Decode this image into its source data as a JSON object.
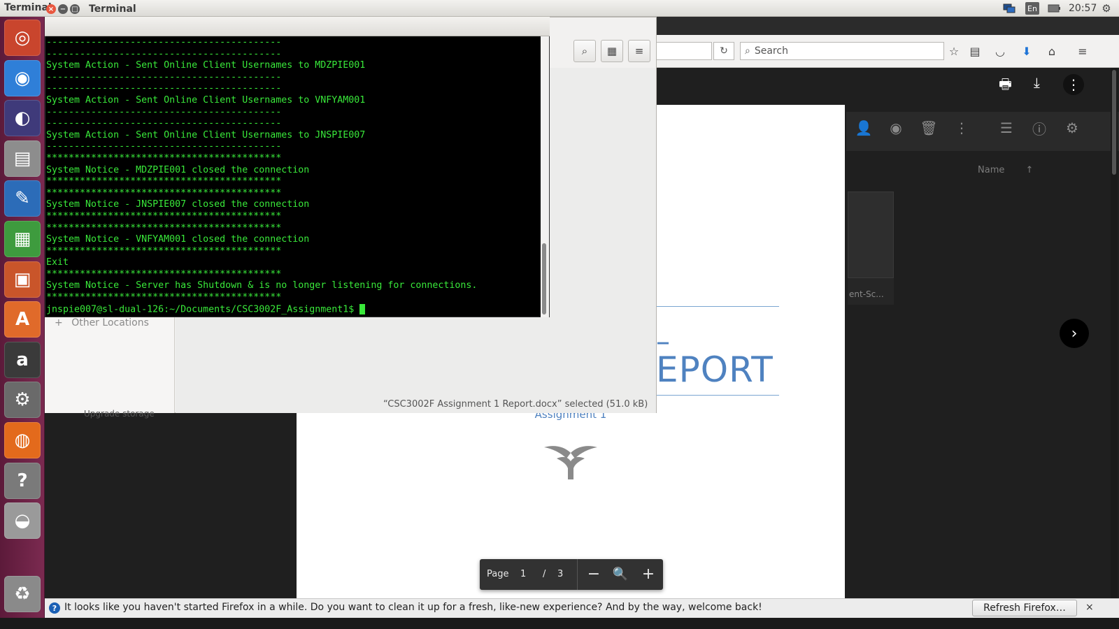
{
  "top_panel": {
    "title": "Terminal",
    "lang": "En",
    "clock": "20:57"
  },
  "launcher": {
    "items": [
      {
        "name": "ubuntu-dash",
        "glyph": "◎",
        "color": "#c9452d"
      },
      {
        "name": "chrome",
        "glyph": "◉",
        "color": "#2f7fd8"
      },
      {
        "name": "eclipse",
        "glyph": "◐",
        "color": "#3f3a7a"
      },
      {
        "name": "files",
        "glyph": "▤",
        "color": "#8d8d8d"
      },
      {
        "name": "writer",
        "glyph": "✎",
        "color": "#2c6cb8"
      },
      {
        "name": "calc",
        "glyph": "▦",
        "color": "#3e9b3e"
      },
      {
        "name": "impress",
        "glyph": "▣",
        "color": "#c9552a"
      },
      {
        "name": "software-center",
        "glyph": "A",
        "color": "#e06a2a"
      },
      {
        "name": "amazon",
        "glyph": "a",
        "color": "#3a3a3a"
      },
      {
        "name": "settings",
        "glyph": "⚙",
        "color": "#6a6a6a"
      },
      {
        "name": "firefox",
        "glyph": "◍",
        "color": "#e36a1c"
      },
      {
        "name": "help",
        "glyph": "?",
        "color": "#7a7a7a"
      },
      {
        "name": "disk",
        "glyph": "◒",
        "color": "#9a9a9a"
      },
      {
        "name": "trash",
        "glyph": "♻",
        "color": "#8a8a8a"
      }
    ]
  },
  "firefox": {
    "search_placeholder": "Search"
  },
  "drive": {
    "name_column": "Name",
    "file_label": "ent-Sc...",
    "upgrade_text": "Upgrade storage"
  },
  "document": {
    "title_dash": "–",
    "title_word": "EPORT",
    "subtitle": "Assignment 1"
  },
  "page_control": {
    "label": "Page",
    "current": "1",
    "separator": "/",
    "total": "3"
  },
  "nautilus": {
    "other_locations": "Other Locations",
    "status": "“CSC3002F Assignment 1 Report.docx” selected  (51.0 kB)"
  },
  "terminal": {
    "title": "Terminal",
    "lines": [
      "------------------------------------------",
      "------------------------------------------",
      "System Action - Sent Online Client Usernames to MDZPIE001",
      "------------------------------------------",
      "------------------------------------------",
      "System Action - Sent Online Client Usernames to VNFYAM001",
      "------------------------------------------",
      "------------------------------------------",
      "System Action - Sent Online Client Usernames to JNSPIE007",
      "------------------------------------------",
      "******************************************",
      "System Notice - MDZPIE001 closed the connection",
      "******************************************",
      "******************************************",
      "System Notice - JNSPIE007 closed the connection",
      "******************************************",
      "******************************************",
      "System Notice - VNFYAM001 closed the connection",
      "******************************************",
      "Exit",
      "******************************************",
      "System Notice - Server has Shutdown & is no longer listening for connections.",
      "******************************************"
    ],
    "prompt": "jnspie007@sl-dual-126:~/Documents/CSC3002F_Assignment1$ "
  },
  "notification": {
    "text": "It looks like you haven't started Firefox in a while. Do you want to clean it up for a fresh, like-new experience? And by the way, welcome back!",
    "button": "Refresh Firefox…",
    "close": "×"
  }
}
